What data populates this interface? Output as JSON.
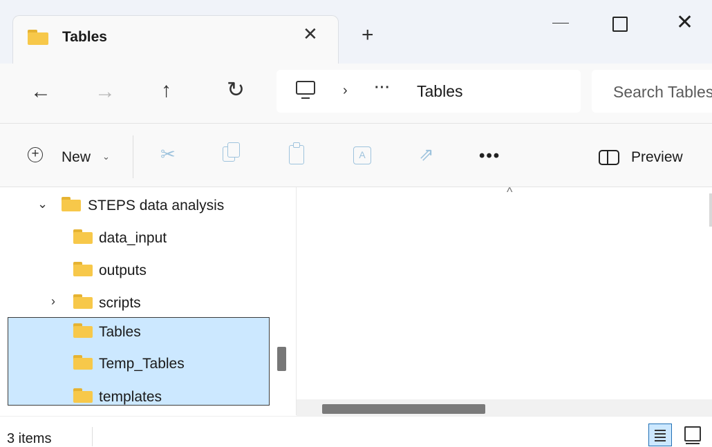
{
  "window": {
    "tab_title": "Tables",
    "tab_close": "✕",
    "new_tab": "+",
    "controls": {
      "minimize": "minimize-icon",
      "maximize": "maximize-icon",
      "close": "✕"
    }
  },
  "nav": {
    "back": "←",
    "forward": "→",
    "up": "↑",
    "refresh": "↻"
  },
  "address": {
    "chevron": "›",
    "ellipsis": "···",
    "current": "Tables"
  },
  "search": {
    "placeholder": "Search Tables"
  },
  "toolbar": {
    "new_plus": "+",
    "new_label": "New",
    "new_caret": "⌄",
    "cut": "✂",
    "rename": "A",
    "share": "⇗",
    "more": "•••",
    "preview_label": "Preview"
  },
  "tree": {
    "items": [
      {
        "label": "STEPS data analysis",
        "chevron": "⌄"
      },
      {
        "label": "data_input"
      },
      {
        "label": "outputs"
      },
      {
        "label": "scripts",
        "chevron": "›"
      },
      {
        "label": "Tables"
      },
      {
        "label": "Temp_Tables"
      },
      {
        "label": "templates"
      }
    ]
  },
  "content": {
    "sort_caret": "^"
  },
  "status": {
    "count": "3 items"
  },
  "colors": {
    "selection": "#cce8ff",
    "folder": "#f7c84a",
    "accent": "#1f6fb5"
  }
}
